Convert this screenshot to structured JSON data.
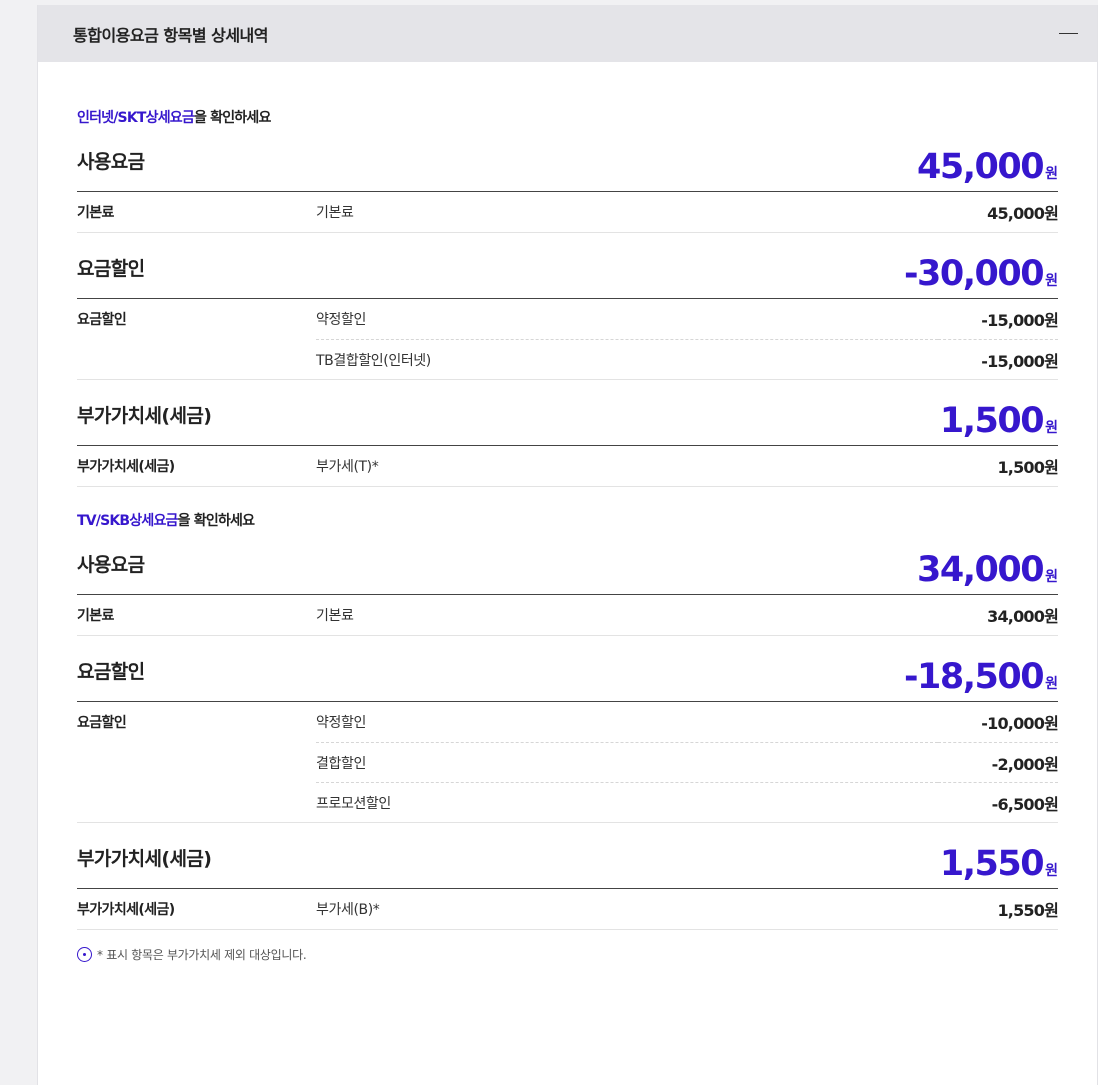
{
  "header": {
    "title": "통합이용요금 항목별 상세내역"
  },
  "sections": [
    {
      "link_accent": "인터넷/SKT상세요금",
      "link_rest": "을 확인하세요",
      "groups": [
        {
          "title": "사용요금",
          "amount": "45,000",
          "unit": "원",
          "rows": [
            {
              "category": "기본료",
              "name": "기본료",
              "amount": "45,000원"
            }
          ]
        },
        {
          "title": "요금할인",
          "amount": "-30,000",
          "unit": "원",
          "rows": [
            {
              "category": "요금할인",
              "name": "약정할인",
              "amount": "-15,000원"
            },
            {
              "category": "",
              "name": "TB결합할인(인터넷)",
              "amount": "-15,000원"
            }
          ]
        },
        {
          "title": "부가가치세(세금)",
          "amount": "1,500",
          "unit": "원",
          "rows": [
            {
              "category": "부가가치세(세금)",
              "name": "부가세(T)*",
              "amount": "1,500원"
            }
          ]
        }
      ]
    },
    {
      "link_accent": "TV/SKB상세요금",
      "link_rest": "을 확인하세요",
      "groups": [
        {
          "title": "사용요금",
          "amount": "34,000",
          "unit": "원",
          "rows": [
            {
              "category": "기본료",
              "name": "기본료",
              "amount": "34,000원"
            }
          ]
        },
        {
          "title": "요금할인",
          "amount": "-18,500",
          "unit": "원",
          "rows": [
            {
              "category": "요금할인",
              "name": "약정할인",
              "amount": "-10,000원"
            },
            {
              "category": "",
              "name": "결합할인",
              "amount": "-2,000원"
            },
            {
              "category": "",
              "name": "프로모션할인",
              "amount": "-6,500원"
            }
          ]
        },
        {
          "title": "부가가치세(세금)",
          "amount": "1,550",
          "unit": "원",
          "rows": [
            {
              "category": "부가가치세(세금)",
              "name": "부가세(B)*",
              "amount": "1,550원"
            }
          ]
        }
      ]
    }
  ],
  "note": {
    "text": "* 표시 항목은 부가가치세 제외 대상입니다.",
    "icon": "info-circle-icon"
  },
  "colors": {
    "accent": "#3617cd",
    "header_bg": "#e4e4e8"
  }
}
